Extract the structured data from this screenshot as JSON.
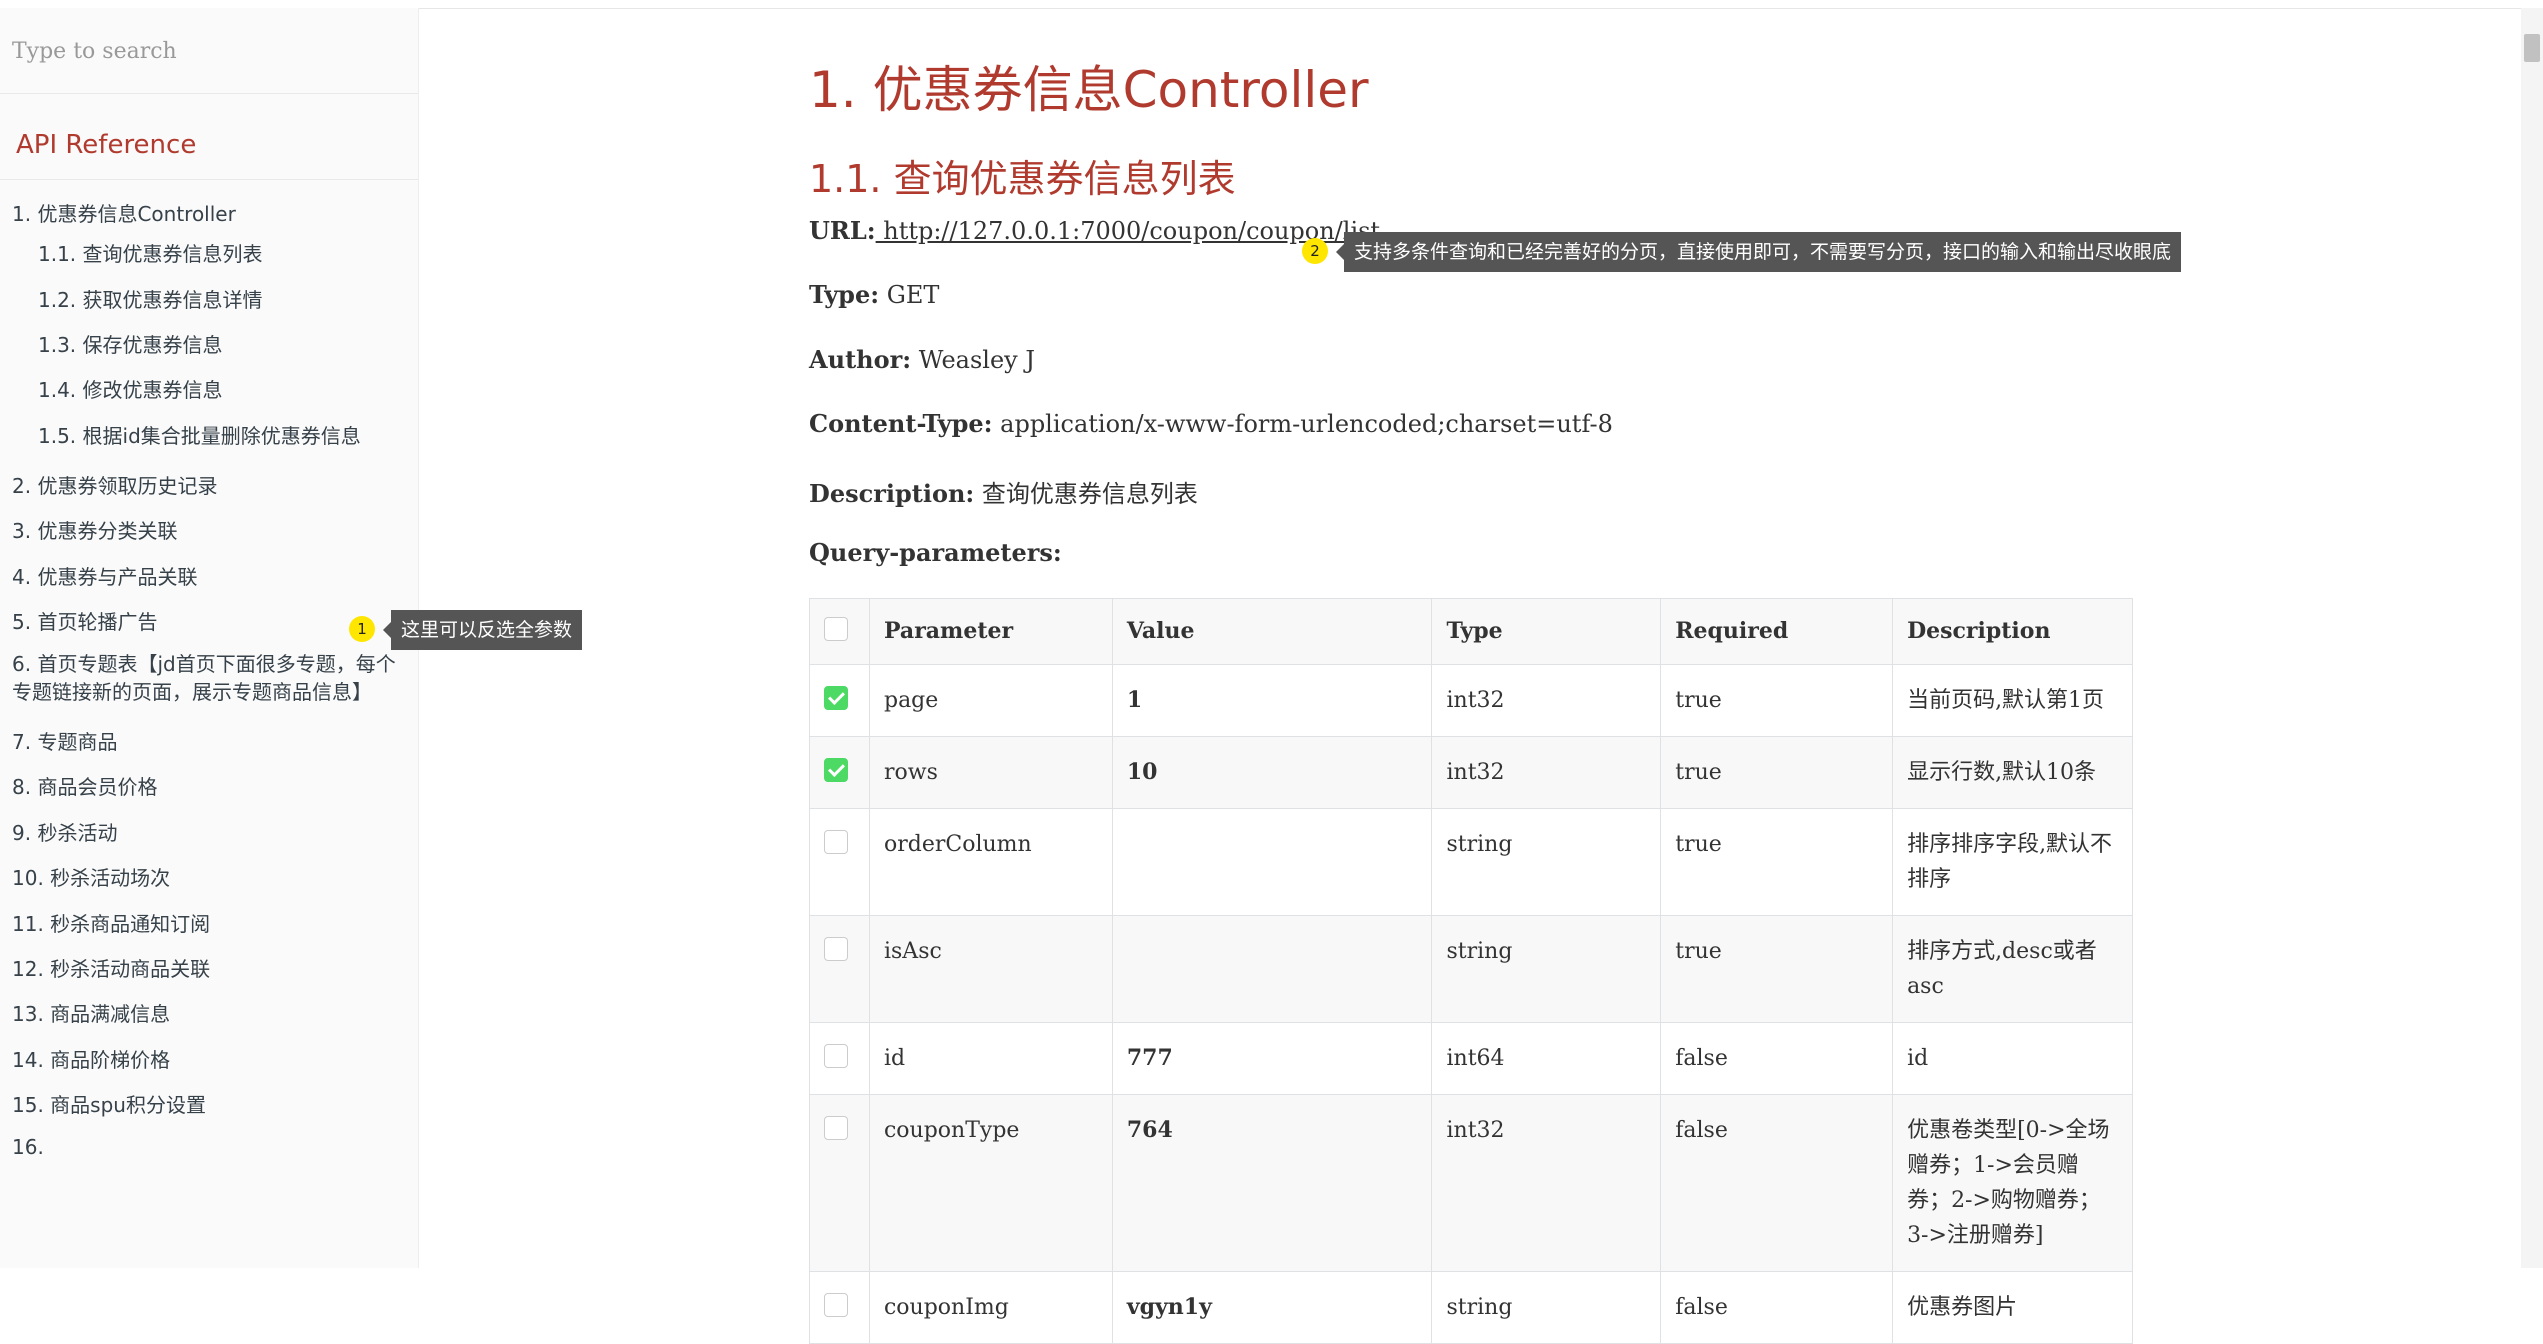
{
  "sidebar": {
    "search_placeholder": "Type to search",
    "title": "API Reference",
    "items": [
      {
        "label": "1. 优惠券信息Controller"
      },
      {
        "label": "1.1. 查询优惠券信息列表"
      },
      {
        "label": "1.2. 获取优惠券信息详情"
      },
      {
        "label": "1.3. 保存优惠券信息"
      },
      {
        "label": "1.4. 修改优惠券信息"
      },
      {
        "label": "1.5. 根据id集合批量删除优惠券信息"
      },
      {
        "label": "2. 优惠券领取历史记录"
      },
      {
        "label": "3. 优惠券分类关联"
      },
      {
        "label": "4. 优惠券与产品关联"
      },
      {
        "label": "5. 首页轮播广告"
      },
      {
        "label": "6. 首页专题表【jd首页下面很多专题，每个专题链接新的页面，展示专题商品信息】"
      },
      {
        "label": "7. 专题商品"
      },
      {
        "label": "8. 商品会员价格"
      },
      {
        "label": "9. 秒杀活动"
      },
      {
        "label": "10. 秒杀活动场次"
      },
      {
        "label": "11. 秒杀商品通知订阅"
      },
      {
        "label": "12. 秒杀活动商品关联"
      },
      {
        "label": "13. 商品满减信息"
      },
      {
        "label": "14. 商品阶梯价格"
      },
      {
        "label": "15. 商品spu积分设置"
      },
      {
        "label": "16."
      }
    ]
  },
  "main": {
    "h1": "1. 优惠券信息Controller",
    "h2": "1.1. 查询优惠券信息列表",
    "url_label": "URL:",
    "url": " http://127.0.0.1:7000/coupon/coupon/list",
    "type_label": "Type:",
    "type": " GET",
    "author_label": "Author:",
    "author": " Weasley J",
    "content_type_label": "Content-Type:",
    "content_type": " application/x-www-form-urlencoded;charset=utf-8",
    "description_label": "Description:",
    "description": " 查询优惠券信息列表",
    "query_params_label": "Query-parameters:"
  },
  "tooltips": {
    "one_badge": "1",
    "one_text": "这里可以反选全参数",
    "two_badge": "2",
    "two_text": "支持多条件查询和已经完善好的分页，直接使用即可，不需要写分页，接口的输入和输出尽收眼底"
  },
  "table": {
    "headers": [
      "Parameter",
      "Value",
      "Type",
      "Required",
      "Description"
    ],
    "rows": [
      {
        "checked": true,
        "parameter": "page",
        "value": "1",
        "type": "int32",
        "required": "true",
        "description": "当前页码,默认第1页"
      },
      {
        "checked": true,
        "parameter": "rows",
        "value": "10",
        "type": "int32",
        "required": "true",
        "description": "显示行数,默认10条"
      },
      {
        "checked": false,
        "parameter": "orderColumn",
        "value": "",
        "type": "string",
        "required": "true",
        "description": "排序排序字段,默认不排序"
      },
      {
        "checked": false,
        "parameter": "isAsc",
        "value": "",
        "type": "string",
        "required": "true",
        "description": "排序方式,desc或者asc"
      },
      {
        "checked": false,
        "parameter": "id",
        "value": "777",
        "type": "int64",
        "required": "false",
        "description": "id"
      },
      {
        "checked": false,
        "parameter": "couponType",
        "value": "764",
        "type": "int32",
        "required": "false",
        "description": "优惠卷类型[0->全场赠券；1->会员赠券；2->购物赠券；3->注册赠券]"
      },
      {
        "checked": false,
        "parameter": "couponImg",
        "value": "vgyn1y",
        "type": "string",
        "required": "false",
        "description": "优惠券图片"
      }
    ]
  }
}
